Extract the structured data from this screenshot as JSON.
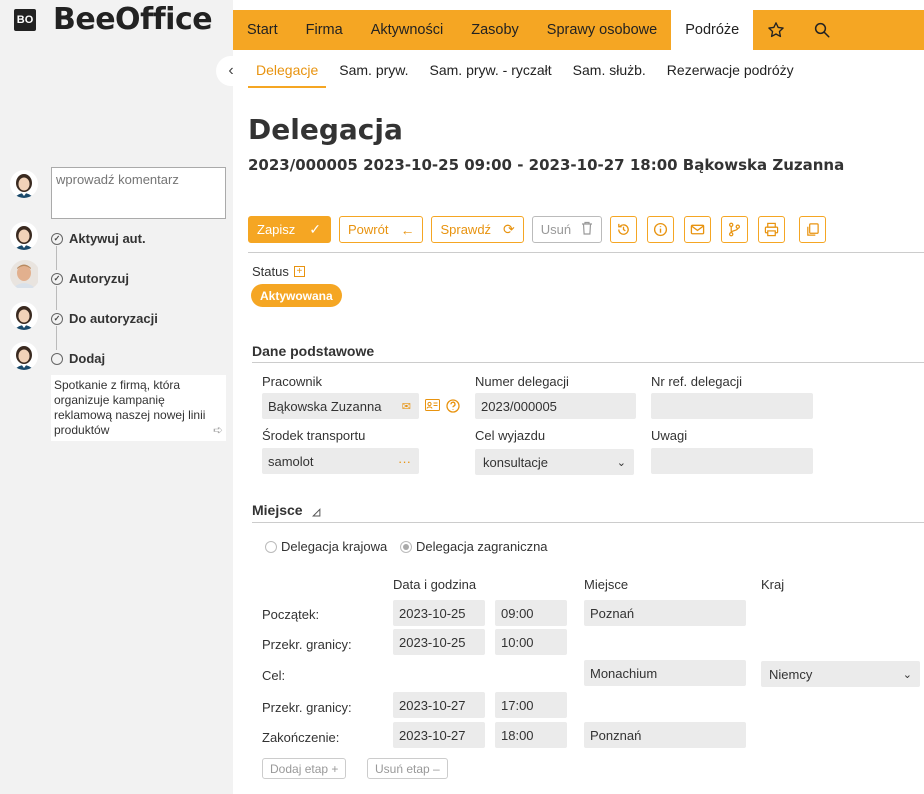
{
  "app": {
    "logo_mark": "BO",
    "logo_text": "BeeOffice"
  },
  "topnav": {
    "tabs": [
      "Start",
      "Firma",
      "Aktywności",
      "Zasoby",
      "Sprawy osobowe",
      "Podróże"
    ],
    "active": "Podróże",
    "icons": [
      "star-icon",
      "search-icon"
    ]
  },
  "subnav": {
    "tabs": [
      "Delegacje",
      "Sam. pryw.",
      "Sam. pryw. - ryczałt",
      "Sam. służb.",
      "Rezerwacje podróży"
    ],
    "active": "Delegacje"
  },
  "page": {
    "title": "Delegacja",
    "subtitle": "2023/000005 2023-10-25 09:00 - 2023-10-27 18:00 Bąkowska Zuzanna"
  },
  "toolbar": {
    "save": "Zapisz",
    "back": "Powrót",
    "check": "Sprawdź",
    "delete": "Usuń"
  },
  "status": {
    "label": "Status",
    "value": "Aktywowana"
  },
  "sidebar": {
    "comment_placeholder": "wprowadź komentarz",
    "workflow": [
      "Aktywuj aut.",
      "Autoryzuj",
      "Do autoryzacji",
      "Dodaj"
    ],
    "note": "Spotkanie z firmą, która organizuje kampanię reklamową naszej nowej linii produktów"
  },
  "basic": {
    "heading": "Dane podstawowe",
    "employee_label": "Pracownik",
    "employee": "Bąkowska Zuzanna",
    "number_label": "Numer delegacji",
    "number": "2023/000005",
    "ref_label": "Nr ref. delegacji",
    "ref": "",
    "transport_label": "Środek transportu",
    "transport": "samolot",
    "purpose_label": "Cel wyjazdu",
    "purpose": "konsultacje",
    "notes_label": "Uwagi",
    "notes": ""
  },
  "place": {
    "heading": "Miejsce",
    "radio_domestic": "Delegacja krajowa",
    "radio_foreign": "Delegacja zagraniczna",
    "selected": "Delegacja zagraniczna",
    "col_datetime": "Data i godzina",
    "col_place": "Miejsce",
    "col_country": "Kraj",
    "rows": {
      "start": {
        "label": "Początek:",
        "date": "2023-10-25",
        "time": "09:00",
        "place": "Poznań"
      },
      "cross1": {
        "label": "Przekr. granicy:",
        "date": "2023-10-25",
        "time": "10:00"
      },
      "dest": {
        "label": "Cel:",
        "place": "Monachium",
        "country": "Niemcy"
      },
      "cross2": {
        "label": "Przekr. granicy:",
        "date": "2023-10-27",
        "time": "17:00"
      },
      "end": {
        "label": "Zakończenie:",
        "date": "2023-10-27",
        "time": "18:00",
        "place": "Ponznań"
      }
    },
    "add_stage": "Dodaj etap +",
    "remove_stage": "Usuń etap –"
  }
}
